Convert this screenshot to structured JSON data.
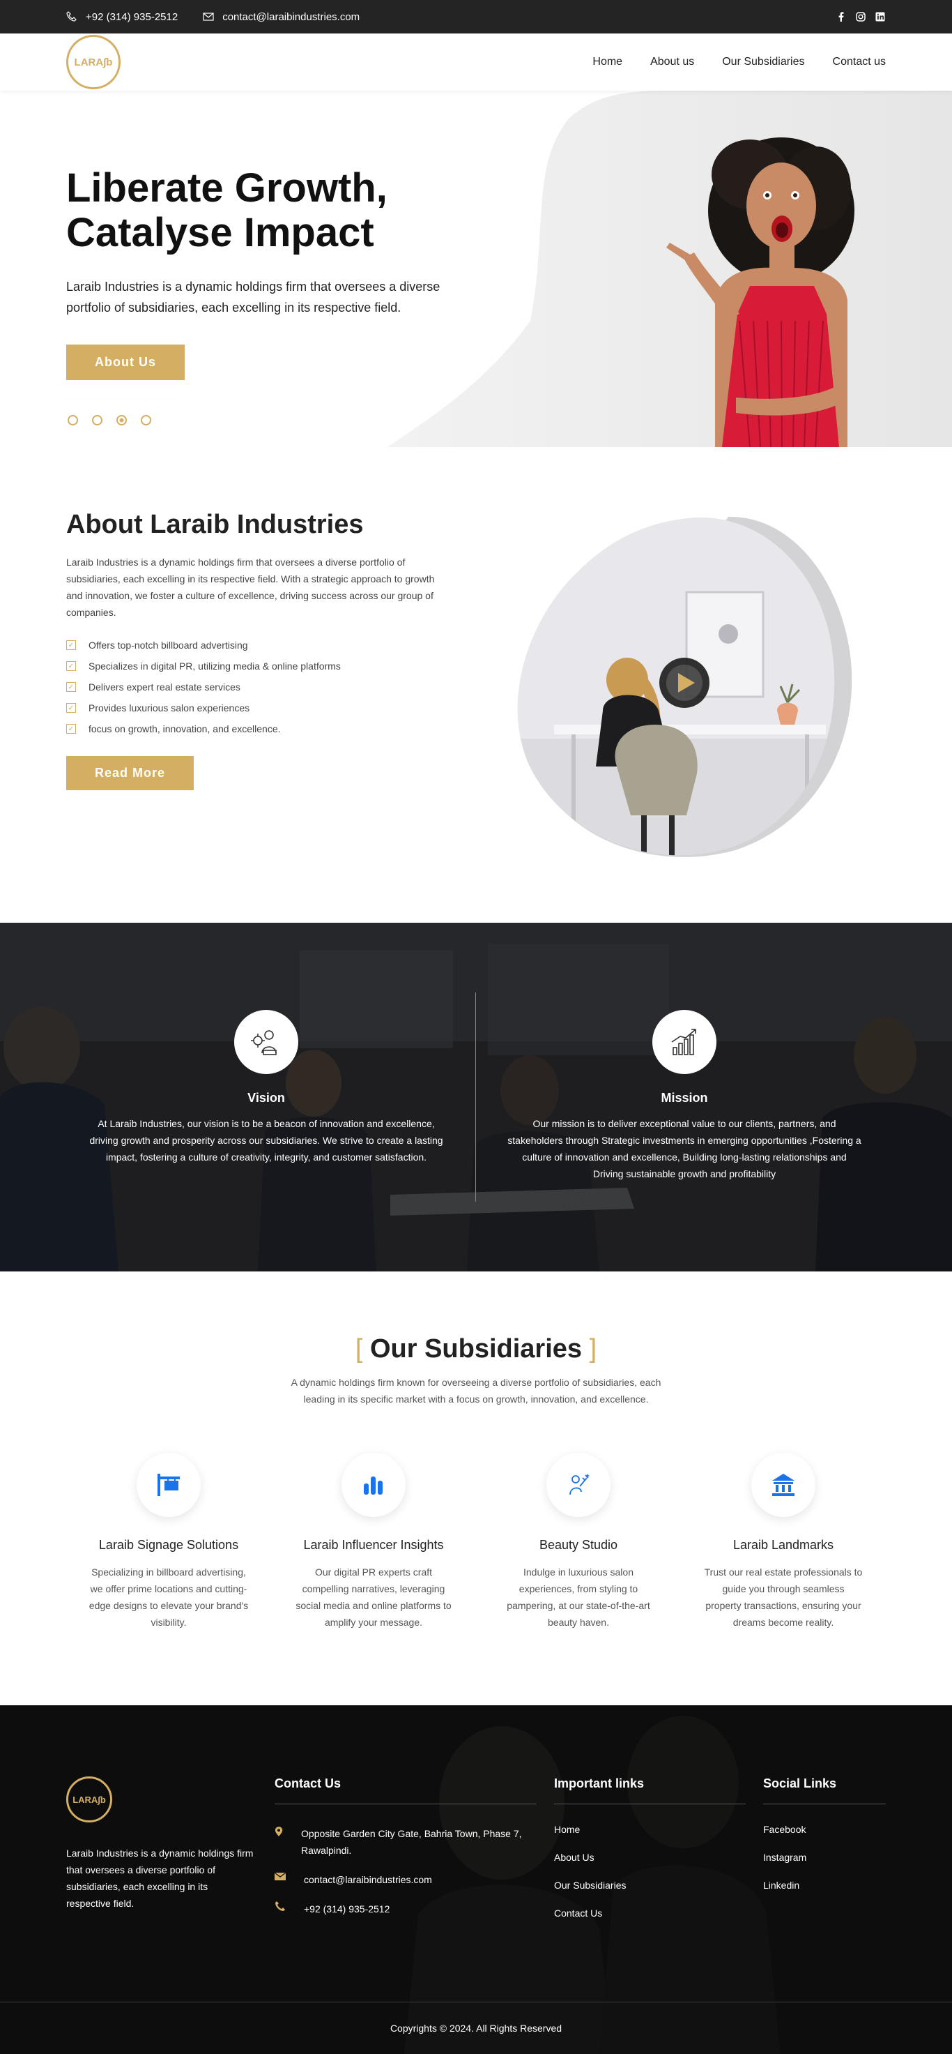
{
  "topbar": {
    "phone": "+92 (314) 935-2512",
    "email": "contact@laraibindustries.com",
    "socials": [
      "facebook-icon",
      "instagram-icon",
      "linkedin-icon"
    ]
  },
  "nav": {
    "logo_text": "LARA∫b",
    "items": [
      "Home",
      "About us",
      "Our Subsidiaries",
      "Contact us"
    ]
  },
  "hero": {
    "title_line1": "Liberate Growth,",
    "title_line2": "Catalyse Impact",
    "text": "Laraib Industries is a dynamic holdings firm that oversees a diverse portfolio of subsidiaries, each excelling in its respective field.",
    "button": "About Us",
    "slides": 4,
    "active_slide": 3
  },
  "about": {
    "title": "About Laraib Industries",
    "text": "Laraib Industries is a dynamic holdings firm that oversees a diverse portfolio of subsidiaries, each excelling in its respective field. With a strategic approach to growth and innovation, we foster a culture of excellence, driving success across our group of companies.",
    "checks": [
      "Offers top-notch billboard advertising",
      "Specializes in digital PR, utilizing media & online platforms",
      "Delivers expert real estate services",
      "Provides luxurious salon experiences",
      "focus on growth, innovation, and excellence."
    ],
    "button": "Read More"
  },
  "vm": {
    "vision_title": "Vision",
    "vision_text": "At Laraib Industries, our vision is to be a beacon of innovation and excellence, driving growth and prosperity across our subsidiaries. We strive to create a lasting impact, fostering a culture of creativity, integrity, and customer satisfaction.",
    "mission_title": "Mission",
    "mission_text": "Our mission is to deliver exceptional value to our clients, partners, and stakeholders through Strategic investments in emerging opportunities ,Fostering a culture of innovation and excellence, Building long-lasting relationships and Driving sustainable growth and profitability"
  },
  "subs": {
    "title": "Our Subsidiaries",
    "intro": "A dynamic holdings firm known for overseeing a diverse portfolio of subsidiaries, each leading in its specific market with a focus on growth, innovation, and excellence.",
    "items": [
      {
        "name": "Laraib Signage Solutions",
        "text": "Specializing in billboard advertising, we offer prime locations and cutting-edge designs to elevate your brand's visibility.",
        "icon": "signboard-icon"
      },
      {
        "name": "Laraib Influencer Insights",
        "text": "Our digital PR experts craft compelling narratives, leveraging social media and online platforms to amplify your message.",
        "icon": "bar-chart-icon"
      },
      {
        "name": "Beauty Studio",
        "text": "Indulge in luxurious salon experiences, from styling to pampering, at our state-of-the-art beauty haven.",
        "icon": "beauty-icon"
      },
      {
        "name": "Laraib Landmarks",
        "text": "Trust our real estate professionals to guide you through seamless property transactions, ensuring your dreams become reality.",
        "icon": "bank-icon"
      }
    ]
  },
  "footer": {
    "about_text": "Laraib Industries is a dynamic holdings firm that oversees a diverse portfolio of subsidiaries, each excelling in its respective field.",
    "contact_title": "Contact Us",
    "address": "Opposite Garden City Gate, Bahria Town, Phase 7, Rawalpindi.",
    "email": "contact@laraibindustries.com",
    "phone": "+92 (314) 935-2512",
    "links_title": "Important links",
    "links": [
      "Home",
      "About Us",
      "Our Subsidiaries",
      "Contact Us"
    ],
    "social_title": "Social Links",
    "social_links": [
      "Facebook",
      "Instagram",
      "Linkedin"
    ],
    "copyright": "Copyrights © 2024. All Rights Reserved"
  },
  "colors": {
    "accent": "#d4ae62",
    "dark": "#242424",
    "icon_blue": "#1a73e8"
  }
}
